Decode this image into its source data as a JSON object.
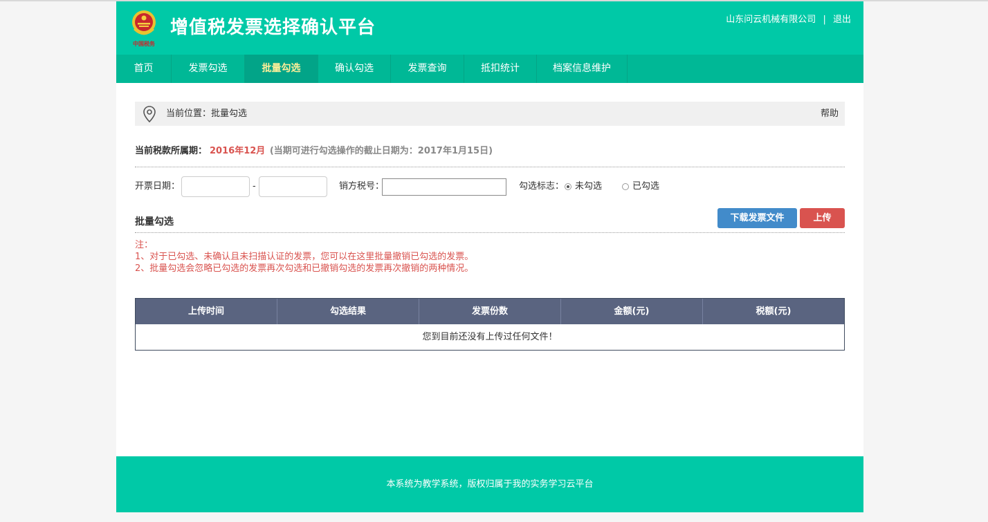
{
  "header": {
    "title": "增值税发票选择确认平台",
    "company": "山东问云机械有限公司",
    "separator": "|",
    "logout": "退出",
    "emblem_caption": "中国税务"
  },
  "nav": {
    "items": [
      {
        "label": "首页"
      },
      {
        "label": "发票勾选"
      },
      {
        "label": "批量勾选"
      },
      {
        "label": "确认勾选"
      },
      {
        "label": "发票查询"
      },
      {
        "label": "抵扣统计"
      },
      {
        "label": "档案信息维护"
      }
    ],
    "active_index": 2
  },
  "breadcrumb": {
    "text": "当前位置：批量勾选",
    "help": "帮助"
  },
  "period": {
    "label": "当前税款所属期：",
    "value": "2016年12月",
    "note": "(当期可进行勾选操作的截止日期为：2017年1月15日)"
  },
  "filters": {
    "date_label": "开票日期：",
    "date_start": "",
    "date_sep": "-",
    "date_end": "",
    "tax_id_label": "销方税号：",
    "tax_id_value": "",
    "flag_label": "勾选标志：",
    "options": [
      {
        "label": "未勾选",
        "checked": true
      },
      {
        "label": "已勾选",
        "checked": false
      }
    ]
  },
  "batch": {
    "title": "批量勾选",
    "download_button": "下载发票文件",
    "upload_button": "上传",
    "notes_title": "注：",
    "notes": [
      "1、对于已勾选、未确认且未扫描认证的发票，您可以在这里批量撤销已勾选的发票。",
      "2、批量勾选会忽略已勾选的发票再次勾选和已撤销勾选的发票再次撤销的两种情况。"
    ]
  },
  "table": {
    "columns": [
      "上传时间",
      "勾选结果",
      "发票份数",
      "金额(元)",
      "税额(元)"
    ],
    "empty_message": "您到目前还没有上传过任何文件！"
  },
  "footer": {
    "text": "本系统为教学系统，版权归属于我的实务学习云平台"
  },
  "colors": {
    "brand": "#00c9a7",
    "nav": "#00b896",
    "nav_active": "#02a488",
    "danger": "#d9534f",
    "primary": "#428bca",
    "table_header": "#5a6480"
  }
}
